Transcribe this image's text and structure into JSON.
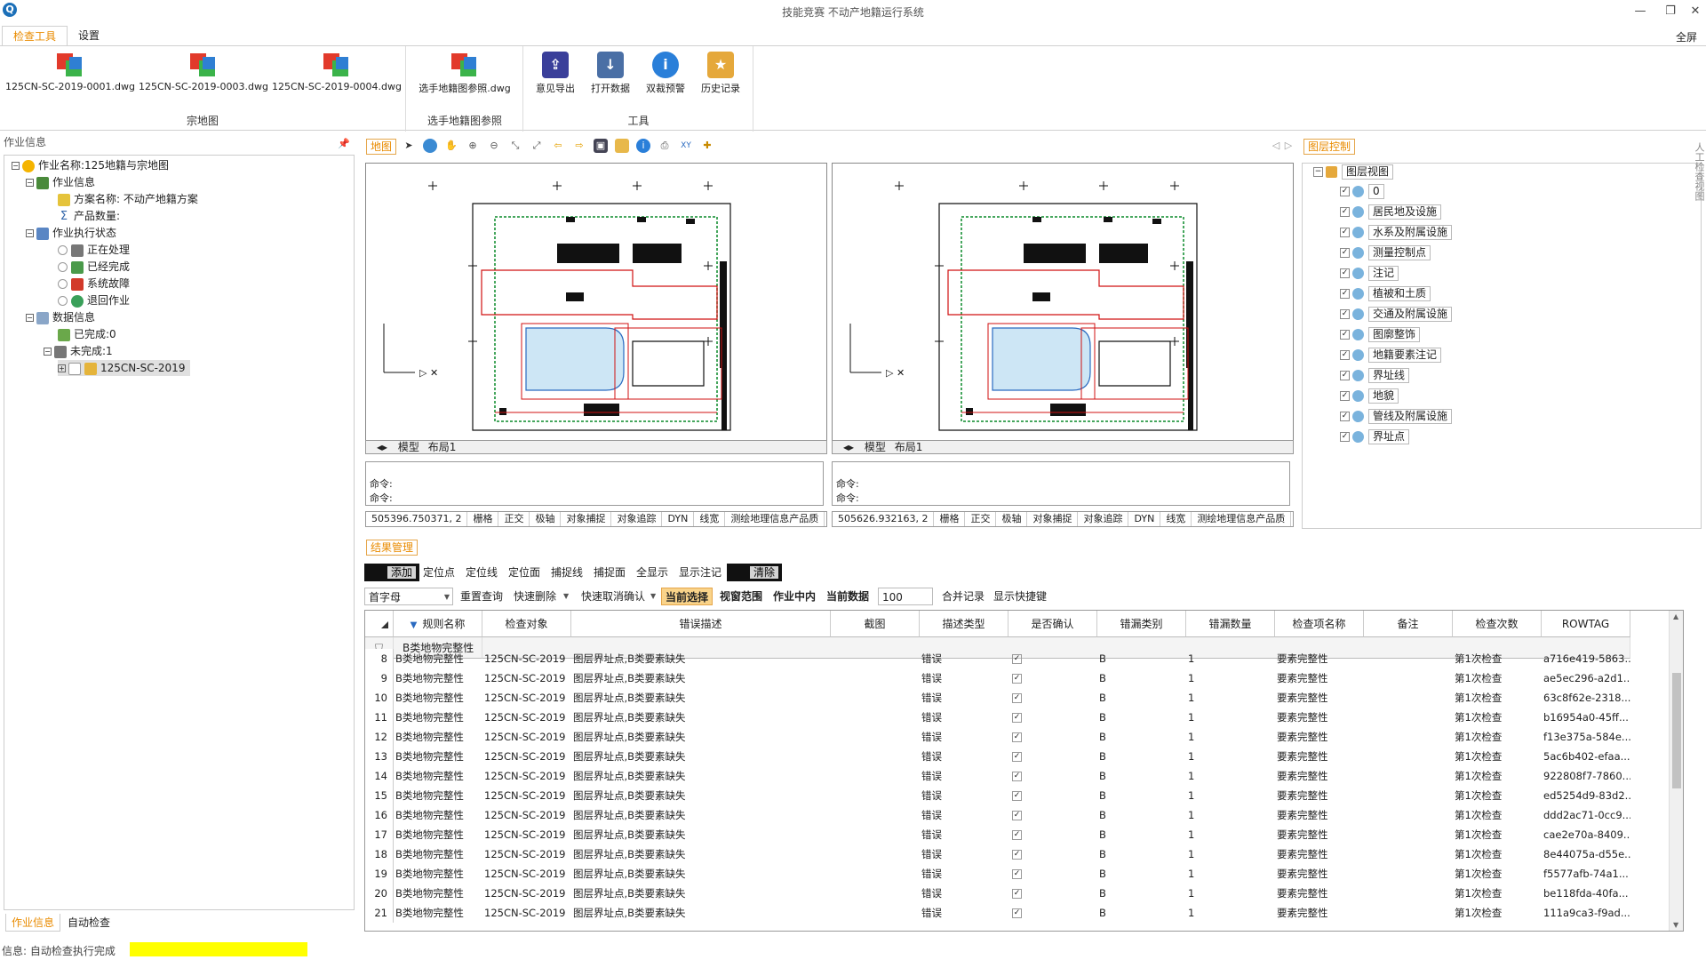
{
  "window": {
    "title": "技能竞赛 不动产地籍运行系统",
    "app_icon": "Q",
    "controls": {
      "minimize": "—",
      "restore": "❐",
      "close": "✕"
    }
  },
  "ribbon": {
    "tabs": [
      {
        "label": "检查工具",
        "active": true
      },
      {
        "label": "设置",
        "active": false
      }
    ],
    "fullscreen_label": "全屏",
    "groups": [
      {
        "label": "宗地图",
        "buttons": [
          "125CN-SC-2019-0001.dwg",
          "125CN-SC-2019-0003.dwg",
          "125CN-SC-2019-0004.dwg"
        ]
      },
      {
        "label": "选手地籍图参照",
        "buttons": [
          "选手地籍图参照.dwg"
        ]
      },
      {
        "label": "工具",
        "buttons": [
          "意见导出",
          "打开数据",
          "双裁预警",
          "历史记录"
        ]
      }
    ]
  },
  "left_panel": {
    "header": "作业信息",
    "pin": "📌",
    "tree": [
      {
        "label": "作业名称:125地籍与宗地图",
        "icon": "sun-icon",
        "toggle": "−"
      },
      {
        "label": "作业信息",
        "icon": "people-icon",
        "toggle": "−"
      },
      {
        "label": "方案名称: 不动产地籍方案",
        "icon": "key-icon"
      },
      {
        "label": "产品数量:",
        "icon": "sigma-icon"
      },
      {
        "label": "作业执行状态",
        "icon": "status-icon",
        "toggle": "−"
      },
      {
        "label": "正在处理",
        "icon": "hourglass-icon"
      },
      {
        "label": "已经完成",
        "icon": "check-icon"
      },
      {
        "label": "系统故障",
        "icon": "error-icon"
      },
      {
        "label": "退回作业",
        "icon": "return-icon"
      },
      {
        "label": "数据信息",
        "icon": "grid-icon",
        "toggle": "−"
      },
      {
        "label": "已完成:0",
        "icon": "doc-icon"
      },
      {
        "label": "未完成:1",
        "icon": "hourglass-icon",
        "toggle": "−"
      },
      {
        "label": "125CN-SC-2019",
        "icon": "lock-icon",
        "toggle": "+"
      }
    ],
    "tabs": [
      {
        "label": "作业信息",
        "active": true
      },
      {
        "label": "自动检查",
        "active": false
      }
    ]
  },
  "status": {
    "text": "信息: 自动检查执行完成",
    "progress": 1.0,
    "color": "#ffff00"
  },
  "map": {
    "tab_label": "地图",
    "views": [
      {
        "model_tab": "模型",
        "layout_tab": "布局1",
        "cmd1": "命令:",
        "cmd2": "命令:",
        "coord": "505396.750371, 2",
        "status_items": [
          "栅格",
          "正交",
          "极轴",
          "对象捕捉",
          "对象追踪",
          "DYN",
          "线宽",
          "测绘地理信息产品质"
        ]
      },
      {
        "model_tab": "模型",
        "layout_tab": "布局1",
        "cmd1": "命令:",
        "cmd2": "命令:",
        "coord": "505626.932163, 2",
        "status_items": [
          "栅格",
          "正交",
          "极轴",
          "对象捕捉",
          "对象追踪",
          "DYN",
          "线宽",
          "测绘地理信息产品质"
        ]
      }
    ]
  },
  "layer_panel": {
    "tab_label": "图层控制",
    "root": "图层视图",
    "layers": [
      "0",
      "居民地及设施",
      "水系及附属设施",
      "测量控制点",
      "注记",
      "植被和土质",
      "交通及附属设施",
      "图廓整饰",
      "地籍要素注记",
      "界址线",
      "地貌",
      "管线及附属设施",
      "界址点"
    ]
  },
  "side_text": "人工检查视图",
  "results": {
    "tab_label": "结果管理",
    "toolbar1": [
      "添加",
      "定位点",
      "定位线",
      "定位面",
      "捕捉线",
      "捕捉面",
      "全显示",
      "显示注记",
      "清除"
    ],
    "filter_select": "首字母",
    "toolbar2": [
      "重置查询",
      "快速删除",
      "快速取消确认",
      "当前选择",
      "视窗范围",
      "作业中内",
      "当前数据"
    ],
    "count_value": "100",
    "toolbar2_tail": [
      "合并记录",
      "显示快捷键"
    ],
    "columns": [
      "规则名称",
      "检查对象",
      "错误描述",
      "截图",
      "描述类型",
      "是否确认",
      "错漏类别",
      "错漏数量",
      "检查项名称",
      "备注",
      "检查次数",
      "ROWTAG"
    ],
    "filter_row_value": "B类地物完整性",
    "rows": [
      {
        "n": "8",
        "rule": "B类地物完整性",
        "obj": "125CN-SC-2019",
        "desc": "图层界址点,B类要素缺失",
        "type": "错误",
        "confirmed": "✓",
        "cat": "B",
        "qty": "1",
        "item": "要素完整性",
        "times": "第1次检查",
        "tag": "a716e419-5863..."
      },
      {
        "n": "9",
        "rule": "B类地物完整性",
        "obj": "125CN-SC-2019",
        "desc": "图层界址点,B类要素缺失",
        "type": "错误",
        "confirmed": "✓",
        "cat": "B",
        "qty": "1",
        "item": "要素完整性",
        "times": "第1次检查",
        "tag": "ae5ec296-a2d1..."
      },
      {
        "n": "10",
        "rule": "B类地物完整性",
        "obj": "125CN-SC-2019",
        "desc": "图层界址点,B类要素缺失",
        "type": "错误",
        "confirmed": "✓",
        "cat": "B",
        "qty": "1",
        "item": "要素完整性",
        "times": "第1次检查",
        "tag": "63c8f62e-2318..."
      },
      {
        "n": "11",
        "rule": "B类地物完整性",
        "obj": "125CN-SC-2019",
        "desc": "图层界址点,B类要素缺失",
        "type": "错误",
        "confirmed": "✓",
        "cat": "B",
        "qty": "1",
        "item": "要素完整性",
        "times": "第1次检查",
        "tag": "b16954a0-45ff..."
      },
      {
        "n": "12",
        "rule": "B类地物完整性",
        "obj": "125CN-SC-2019",
        "desc": "图层界址点,B类要素缺失",
        "type": "错误",
        "confirmed": "✓",
        "cat": "B",
        "qty": "1",
        "item": "要素完整性",
        "times": "第1次检查",
        "tag": "f13e375a-584e..."
      },
      {
        "n": "13",
        "rule": "B类地物完整性",
        "obj": "125CN-SC-2019",
        "desc": "图层界址点,B类要素缺失",
        "type": "错误",
        "confirmed": "✓",
        "cat": "B",
        "qty": "1",
        "item": "要素完整性",
        "times": "第1次检查",
        "tag": "5ac6b402-efaa..."
      },
      {
        "n": "14",
        "rule": "B类地物完整性",
        "obj": "125CN-SC-2019",
        "desc": "图层界址点,B类要素缺失",
        "type": "错误",
        "confirmed": "✓",
        "cat": "B",
        "qty": "1",
        "item": "要素完整性",
        "times": "第1次检查",
        "tag": "922808f7-7860..."
      },
      {
        "n": "15",
        "rule": "B类地物完整性",
        "obj": "125CN-SC-2019",
        "desc": "图层界址点,B类要素缺失",
        "type": "错误",
        "confirmed": "✓",
        "cat": "B",
        "qty": "1",
        "item": "要素完整性",
        "times": "第1次检查",
        "tag": "ed5254d9-83d2..."
      },
      {
        "n": "16",
        "rule": "B类地物完整性",
        "obj": "125CN-SC-2019",
        "desc": "图层界址点,B类要素缺失",
        "type": "错误",
        "confirmed": "✓",
        "cat": "B",
        "qty": "1",
        "item": "要素完整性",
        "times": "第1次检查",
        "tag": "ddd2ac71-0cc9..."
      },
      {
        "n": "17",
        "rule": "B类地物完整性",
        "obj": "125CN-SC-2019",
        "desc": "图层界址点,B类要素缺失",
        "type": "错误",
        "confirmed": "✓",
        "cat": "B",
        "qty": "1",
        "item": "要素完整性",
        "times": "第1次检查",
        "tag": "cae2e70a-8409..."
      },
      {
        "n": "18",
        "rule": "B类地物完整性",
        "obj": "125CN-SC-2019",
        "desc": "图层界址点,B类要素缺失",
        "type": "错误",
        "confirmed": "✓",
        "cat": "B",
        "qty": "1",
        "item": "要素完整性",
        "times": "第1次检查",
        "tag": "8e44075a-d55e..."
      },
      {
        "n": "19",
        "rule": "B类地物完整性",
        "obj": "125CN-SC-2019",
        "desc": "图层界址点,B类要素缺失",
        "type": "错误",
        "confirmed": "✓",
        "cat": "B",
        "qty": "1",
        "item": "要素完整性",
        "times": "第1次检查",
        "tag": "f5577afb-74a1..."
      },
      {
        "n": "20",
        "rule": "B类地物完整性",
        "obj": "125CN-SC-2019",
        "desc": "图层界址点,B类要素缺失",
        "type": "错误",
        "confirmed": "✓",
        "cat": "B",
        "qty": "1",
        "item": "要素完整性",
        "times": "第1次检查",
        "tag": "be118fda-40fa..."
      },
      {
        "n": "21",
        "rule": "B类地物完整性",
        "obj": "125CN-SC-2019",
        "desc": "图层界址点,B类要素缺失",
        "type": "错误",
        "confirmed": "✓",
        "cat": "B",
        "qty": "1",
        "item": "要素完整性",
        "times": "第1次检查",
        "tag": "111a9ca3-f9ad..."
      }
    ]
  }
}
